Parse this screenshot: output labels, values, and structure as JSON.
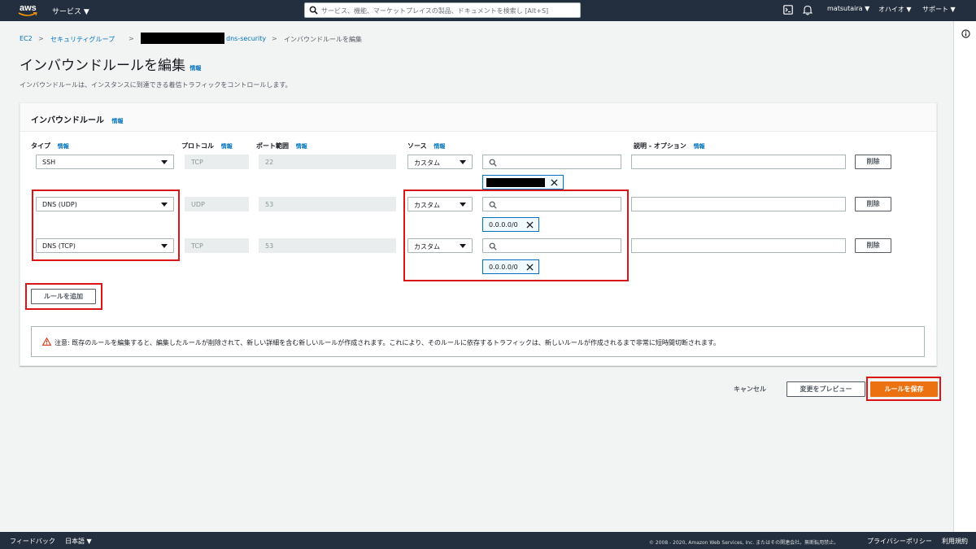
{
  "nav": {
    "logo_text": "aws",
    "services_label": "サービス ▼",
    "search_placeholder": "サービス、機能、マーケットプレイスの製品、ドキュメントを検索し   [Alt+S]",
    "user_label": "matsutaira ▼",
    "region_label": "オハイオ ▼",
    "support_label": "サポート ▼",
    "colors": {
      "bar": "#232f3e",
      "accent": "#ec7211",
      "link": "#0073bb",
      "highlight": "#d91515"
    }
  },
  "breadcrumb": {
    "items": [
      "EC2",
      "セキュリティグループ",
      "dns-security",
      "インバウンドルールを編集"
    ],
    "separator": ">"
  },
  "header": {
    "title": "インバウンドルールを編集",
    "info": "情報",
    "description": "インバウンドルールは、インスタンスに到達できる着信トラフィックをコントロールします。"
  },
  "panel": {
    "title": "インバウンドルール",
    "info": "情報",
    "columns": {
      "type": "タイプ",
      "protocol": "プロトコル",
      "port": "ポート範囲",
      "source": "ソース",
      "description": "説明 - オプション",
      "info": "情報"
    },
    "rules": [
      {
        "type": "SSH",
        "protocol": "TCP",
        "port": "22",
        "source_type": "カスタム",
        "token": "",
        "delete": "削除"
      },
      {
        "type": "DNS (UDP)",
        "protocol": "UDP",
        "port": "53",
        "source_type": "カスタム",
        "token": "0.0.0.0/0",
        "delete": "削除"
      },
      {
        "type": "DNS (TCP)",
        "protocol": "TCP",
        "port": "53",
        "source_type": "カスタム",
        "token": "0.0.0.0/0",
        "delete": "削除"
      }
    ],
    "add_rule": "ルールを追加",
    "warning": "注意: 既存のルールを編集すると、編集したルールが削除されて、新しい詳細を含む新しいルールが作成されます。これにより、そのルールに依存するトラフィックは、新しいルールが作成されるまで非常に短時間切断されます。"
  },
  "actions": {
    "cancel": "キャンセル",
    "preview": "変更をプレビュー",
    "save": "ルールを保存"
  },
  "footer": {
    "feedback": "フィードバック",
    "language": "日本語 ▼",
    "copyright": "© 2008 - 2020, Amazon Web Services, Inc. またはその関連会社。無断転用禁止。",
    "privacy": "プライバシーポリシー",
    "terms": "利用規約"
  }
}
